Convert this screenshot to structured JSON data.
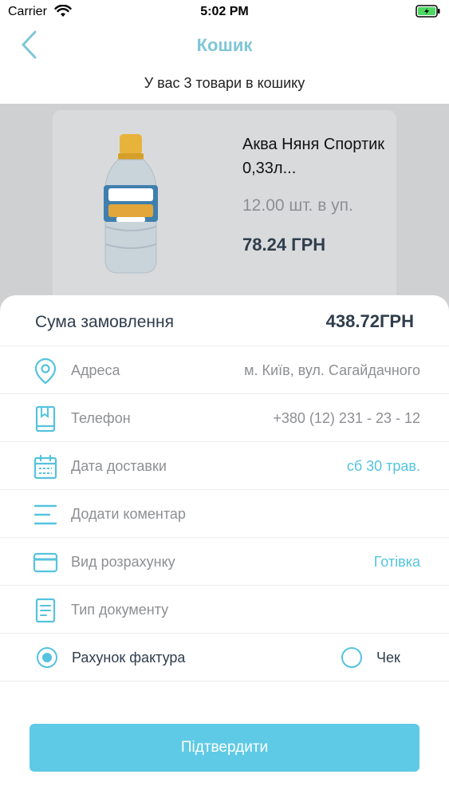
{
  "status_bar": {
    "carrier": "Carrier",
    "time": "5:02 PM"
  },
  "nav": {
    "title": "Кошик"
  },
  "cart": {
    "count_text": "У вас 3 товари в кошику"
  },
  "product": {
    "name": "Аква Няня Спортик 0,33л...",
    "pack": "12.00 шт. в уп.",
    "price": "78.24 ГРН"
  },
  "order": {
    "sum_label": "Сума замовлення",
    "sum_value": "438.72ГРН",
    "rows": [
      {
        "label": "Адреса",
        "value": "м. Київ, вул. Сагайдачного",
        "icon": "location-pin-icon"
      },
      {
        "label": "Телефон",
        "value": "+380 (12) 231 - 23 - 12",
        "icon": "phone-icon"
      },
      {
        "label": "Дата доставки",
        "value": "сб 30 трав.",
        "icon": "calendar-icon"
      },
      {
        "label": "Додати коментар",
        "value": "",
        "icon": "comment-lines-icon"
      },
      {
        "label": "Вид розрахунку",
        "value": "Готівка",
        "icon": "credit-card-icon"
      },
      {
        "label": "Тип документу",
        "value": "",
        "icon": "document-icon"
      }
    ],
    "document_types": [
      {
        "label": "Рахунок фактура",
        "selected": true
      },
      {
        "label": "Чек",
        "selected": false
      }
    ],
    "confirm_label": "Підтвердити"
  },
  "colors": {
    "accent": "#55c3df",
    "title": "#7fc6d8",
    "button": "#5fcae6",
    "battery": "#4cd964"
  }
}
